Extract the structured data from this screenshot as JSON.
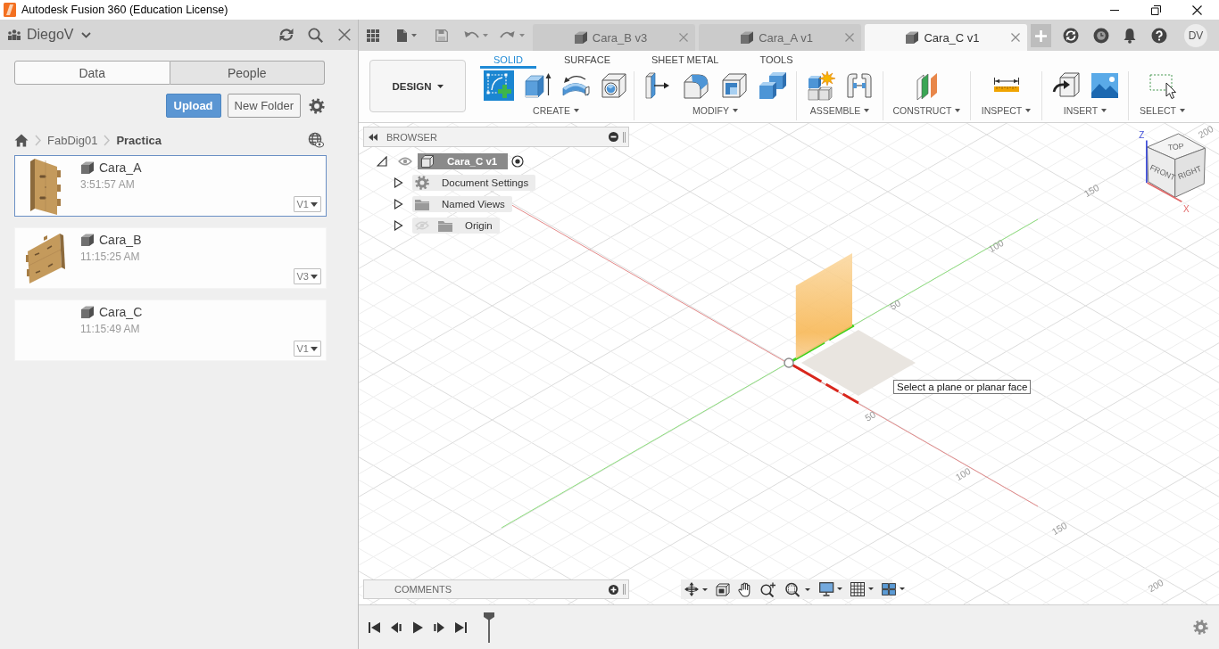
{
  "window": {
    "title": "Autodesk Fusion 360 (Education License)"
  },
  "data_panel": {
    "user": "DiegoV",
    "tabs": [
      {
        "label": "Data",
        "selected": true
      },
      {
        "label": "People",
        "selected": false
      }
    ],
    "actions": [
      {
        "label": "Upload",
        "kind": "primary"
      },
      {
        "label": "New Folder",
        "kind": "secondary"
      }
    ],
    "breadcrumb": [
      "FabDig01",
      "Practica"
    ],
    "files": [
      {
        "name": "Cara_A",
        "time": "3:51:57 AM",
        "version": "V1",
        "selected": true,
        "kind": "upright"
      },
      {
        "name": "Cara_B",
        "time": "11:15:25 AM",
        "version": "V3",
        "selected": false,
        "kind": "tilted"
      },
      {
        "name": "Cara_C",
        "time": "11:15:49 AM",
        "version": "V1",
        "selected": false,
        "kind": "blank"
      }
    ]
  },
  "document_tabs": [
    {
      "label": "Cara_B v3",
      "selected": false
    },
    {
      "label": "Cara_A v1",
      "selected": false
    },
    {
      "label": "Cara_C v1",
      "selected": true
    }
  ],
  "account": {
    "initials": "DV"
  },
  "toolbar": {
    "workspace": "DESIGN",
    "tabs": [
      {
        "label": "SOLID",
        "selected": true
      },
      {
        "label": "SURFACE",
        "selected": false
      },
      {
        "label": "SHEET METAL",
        "selected": false
      },
      {
        "label": "TOOLS",
        "selected": false
      }
    ],
    "groups": [
      {
        "label": "CREATE",
        "tools": [
          {
            "active": true
          },
          {
            "active": false
          },
          {
            "active": false
          },
          {
            "active": false
          }
        ]
      },
      {
        "label": "MODIFY",
        "tools": [
          {
            "active": false
          },
          {
            "active": false
          },
          {
            "active": false
          },
          {
            "active": false
          }
        ]
      },
      {
        "label": "ASSEMBLE",
        "tools": [
          {
            "active": false
          },
          {
            "active": false
          }
        ]
      },
      {
        "label": "CONSTRUCT",
        "tools": [
          {
            "active": false
          }
        ]
      },
      {
        "label": "INSPECT",
        "tools": [
          {
            "active": false
          }
        ]
      },
      {
        "label": "INSERT",
        "tools": [
          {
            "active": false
          },
          {
            "active": false
          }
        ]
      },
      {
        "label": "SELECT",
        "tools": [
          {
            "active": false
          }
        ]
      }
    ]
  },
  "browser": {
    "title": "BROWSER",
    "root": {
      "label": "Cara_C v1",
      "expanded": true,
      "visible": true,
      "active": true,
      "selected": true,
      "children": [
        {
          "label": "Document Settings",
          "kind": "settings",
          "expanded": false,
          "selected": false
        },
        {
          "label": "Named Views",
          "kind": "folder",
          "expanded": false,
          "selected": false
        },
        {
          "label": "Origin",
          "kind": "folder",
          "expanded": false,
          "visible": false,
          "selected": false
        }
      ]
    }
  },
  "viewport": {
    "prompt": "Select a plane or planar face",
    "green_axis_labels": [
      "50",
      "100",
      "150",
      "200"
    ],
    "red_axis_labels": [
      "50",
      "100",
      "150",
      "200"
    ],
    "view_cube": {
      "faces": [
        "TOP",
        "FRONT",
        "RIGHT"
      ],
      "axes": [
        "Z",
        "X"
      ]
    }
  },
  "comments": {
    "title": "COMMENTS"
  }
}
